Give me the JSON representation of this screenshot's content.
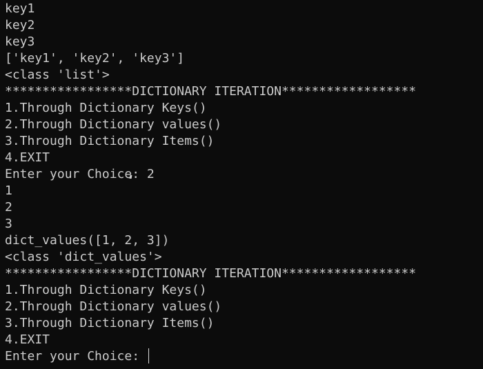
{
  "terminal": {
    "lines": [
      "key1",
      "key2",
      "key3",
      "['key1', 'key2', 'key3']",
      "<class 'list'>",
      "*****************DICTIONARY ITERATION******************",
      "1.Through Dictionary Keys()",
      "2.Through Dictionary values()",
      "3.Through Dictionary Items()",
      "4.EXIT",
      "Enter your Choice: 2",
      "1",
      "2",
      "3",
      "dict_values([1, 2, 3])",
      "<class 'dict_values'>",
      "*****************DICTIONARY ITERATION******************",
      "1.Through Dictionary Keys()",
      "2.Through Dictionary values()",
      "3.Through Dictionary Items()",
      "4.EXIT",
      "Enter your Choice: "
    ],
    "colors": {
      "background": "#0c0c0c",
      "text": "#cccccc",
      "cursor": "#d9d9d9"
    }
  }
}
